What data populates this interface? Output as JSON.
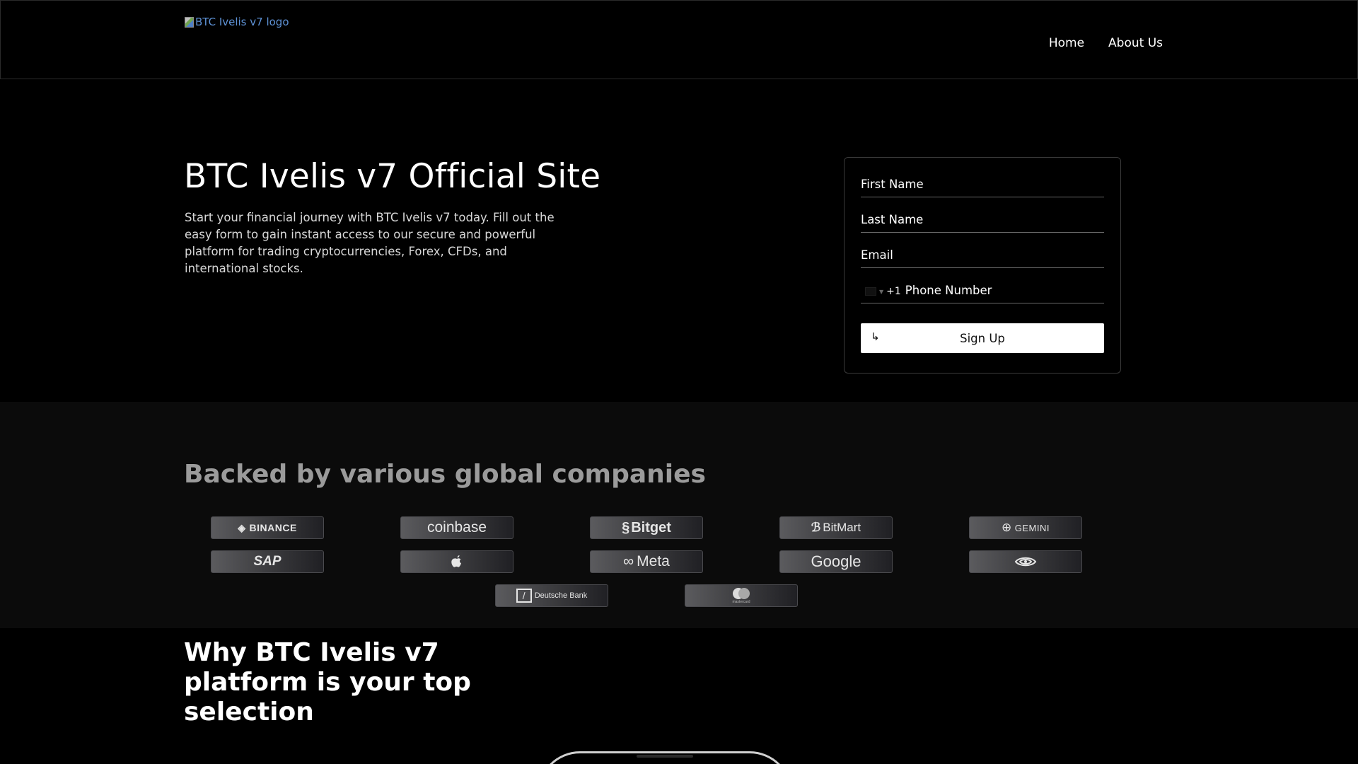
{
  "header": {
    "logo_alt": "BTC Ivelis v7 logo",
    "nav": [
      "Home",
      "About Us"
    ]
  },
  "hero": {
    "title": "BTC Ivelis v7 Official Site",
    "description": "Start your financial journey with BTC Ivelis v7 today. Fill out the easy form to gain instant access to our secure and powerful platform for trading cryptocurrencies, Forex, CFDs, and international stocks."
  },
  "form": {
    "first_name_placeholder": "First Name",
    "last_name_placeholder": "Last Name",
    "email_placeholder": "Email",
    "phone_code": "+1",
    "phone_placeholder": "Phone Number",
    "submit_label": "Sign Up",
    "submit_icon": "↳"
  },
  "companies": {
    "title": "Backed by various global companies",
    "logos": [
      "BINANCE",
      "coinbase",
      "Bitget",
      "BitMart",
      "GEMINI",
      "SAP",
      "",
      "Meta",
      "Google",
      "",
      "Deutsche Bank",
      "mastercard"
    ]
  },
  "why": {
    "title": "Why BTC Ivelis v7 platform is your top selection"
  },
  "colors": {
    "background": "#000000",
    "band": "#0b0b0b",
    "link_blue": "#5e92d6",
    "muted_heading": "#9b9b9b"
  }
}
